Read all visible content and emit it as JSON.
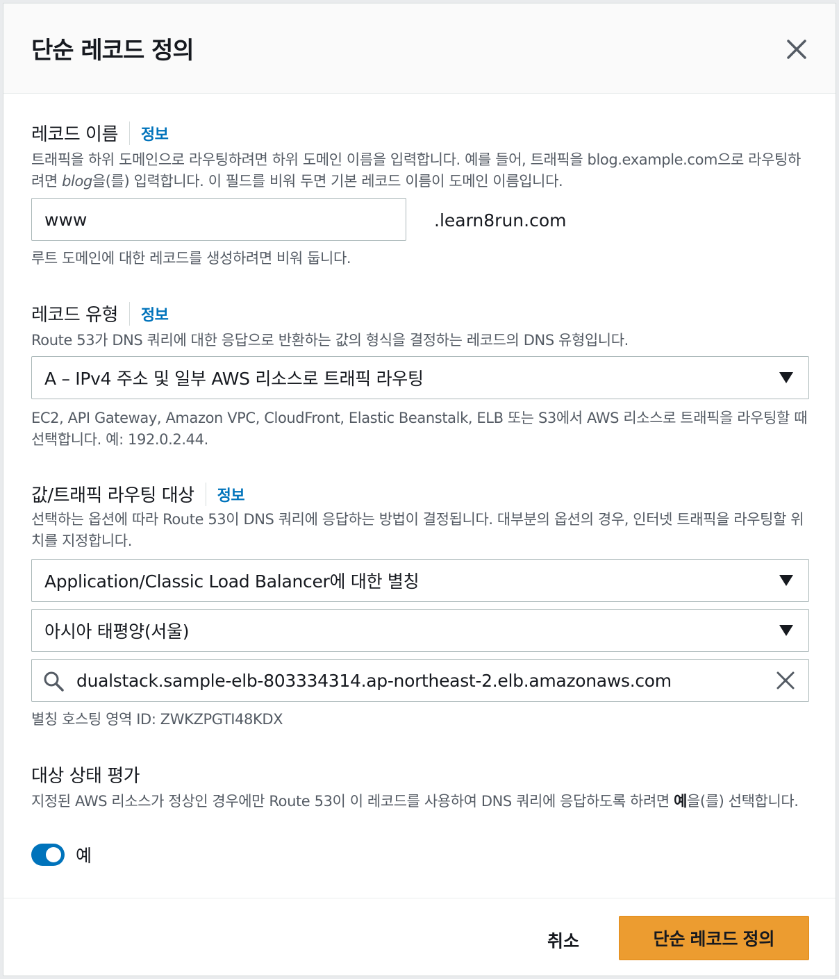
{
  "modal": {
    "title": "단순 레코드 정의"
  },
  "record_name": {
    "label": "레코드 이름",
    "info": "정보",
    "desc_1": "트래픽을 하위 도메인으로 라우팅하려면 하위 도메인 이름을 입력합니다. 예를 들어, 트래픽을 blog.example.com으로 라우팅하려면 ",
    "desc_italic": "blog",
    "desc_2": "을(를) 입력합니다. 이 필드를 비워 두면 기본 레코드 이름이 도메인 이름입니다.",
    "value": "www",
    "domain_suffix": ".learn8run.com",
    "hint": "루트 도메인에 대한 레코드를 생성하려면 비워 둡니다."
  },
  "record_type": {
    "label": "레코드 유형",
    "info": "정보",
    "desc": "Route 53가 DNS 쿼리에 대한 응답으로 반환하는 값의 형식을 결정하는 레코드의 DNS 유형입니다.",
    "selected": "A – IPv4 주소 및 일부 AWS 리소스로 트래픽 라우팅",
    "hint": "EC2, API Gateway, Amazon VPC, CloudFront, Elastic Beanstalk, ELB 또는 S3에서 AWS 리소스로 트래픽을 라우팅할 때 선택합니다. 예: 192.0.2.44."
  },
  "routing_target": {
    "label": "값/트래픽 라우팅 대상",
    "info": "정보",
    "desc": "선택하는 옵션에 따라 Route 53이 DNS 쿼리에 응답하는 방법이 결정됩니다. 대부분의 옵션의 경우, 인터넷 트래픽을 라우팅할 위치를 지정합니다.",
    "endpoint_selected": "Application/Classic Load Balancer에 대한 별칭",
    "region_selected": "아시아 태평양(서울)",
    "search_value": "dualstack.sample-elb-803334314.ap-northeast-2.elb.amazonaws.com",
    "hosted_zone": "별칭 호스팅 영역 ID: ZWKZPGTI48KDX"
  },
  "health": {
    "label": "대상 상태 평가",
    "desc_1": "지정된 AWS 리소스가 정상인 경우에만 Route 53이 이 레코드를 사용하여 DNS 쿼리에 응답하도록 하려면 ",
    "desc_bold": "예",
    "desc_2": "을(를) 선택합니다.",
    "toggle_label": "예"
  },
  "footer": {
    "cancel": "취소",
    "submit": "단순 레코드 정의"
  },
  "colors": {
    "primary_button": "#ec9c30",
    "link": "#0073bb",
    "toggle_on": "#0073bb"
  }
}
